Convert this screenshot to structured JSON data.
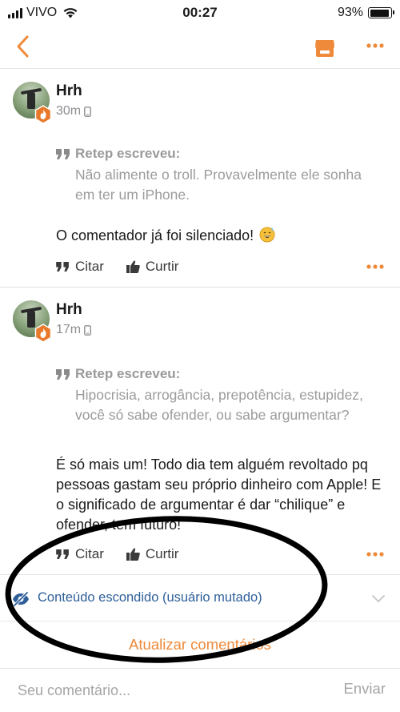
{
  "status_bar": {
    "carrier": "VIVO",
    "time": "00:27",
    "battery": "93%",
    "battery_level": 0.93
  },
  "nav": {
    "back_icon": "chevron-left-icon",
    "store_icon": "store-icon",
    "more_icon": "more-horizontal-icon"
  },
  "comments": [
    {
      "author": "Hrh",
      "time": "30m",
      "quote_author": "Retep escreveu:",
      "quote_text": "Não alimente o troll. Provavelmente ele sonha em ter um iPhone.",
      "body": "O comentador já foi silenciado!",
      "emoji": "grinning-sweat-emoji",
      "cite_label": "Citar",
      "like_label": "Curtir"
    },
    {
      "author": "Hrh",
      "time": "17m",
      "quote_author": "Retep escreveu:",
      "quote_text": "Hipocrisia, arrogância, prepotência, estupidez, você só sabe ofender, ou sabe argumentar?",
      "body": "É só mais um! Todo dia tem alguém revoltado pq pessoas gastam seu próprio dinheiro com Apple! E o significado de argumentar é dar “chilique” e ofender, tem futuro!",
      "cite_label": "Citar",
      "like_label": "Curtir"
    }
  ],
  "hidden_content": {
    "label": "Conteúdo escondido (usuário mutado)"
  },
  "refresh_label": "Atualizar comentários",
  "composer": {
    "placeholder": "Seu comentário...",
    "send_label": "Enviar"
  },
  "colors": {
    "accent": "#ef8a3a",
    "link_blue": "#2e5f99",
    "muted": "#9b9b9b"
  }
}
